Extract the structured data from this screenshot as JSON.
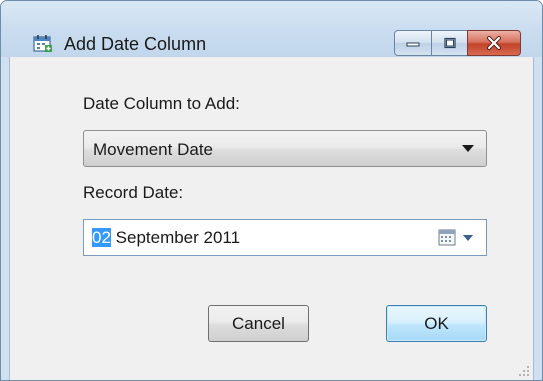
{
  "window": {
    "title": "Add Date Column",
    "icon": "calendar-add-icon",
    "caption_buttons": [
      "minimize-icon",
      "maximize-icon",
      "close-icon"
    ]
  },
  "form": {
    "date_column_label": "Date Column to Add:",
    "date_column_value": "Movement Date",
    "record_date_label": "Record Date:",
    "record_date_day": "02",
    "record_date_rest": " September 2011",
    "record_date_button_icon": "calendar-icon"
  },
  "buttons": {
    "cancel": "Cancel",
    "ok": "OK"
  },
  "colors": {
    "selection": "#3399ff",
    "close_button": "#c2432a",
    "default_button_border": "#3c7fb1"
  }
}
